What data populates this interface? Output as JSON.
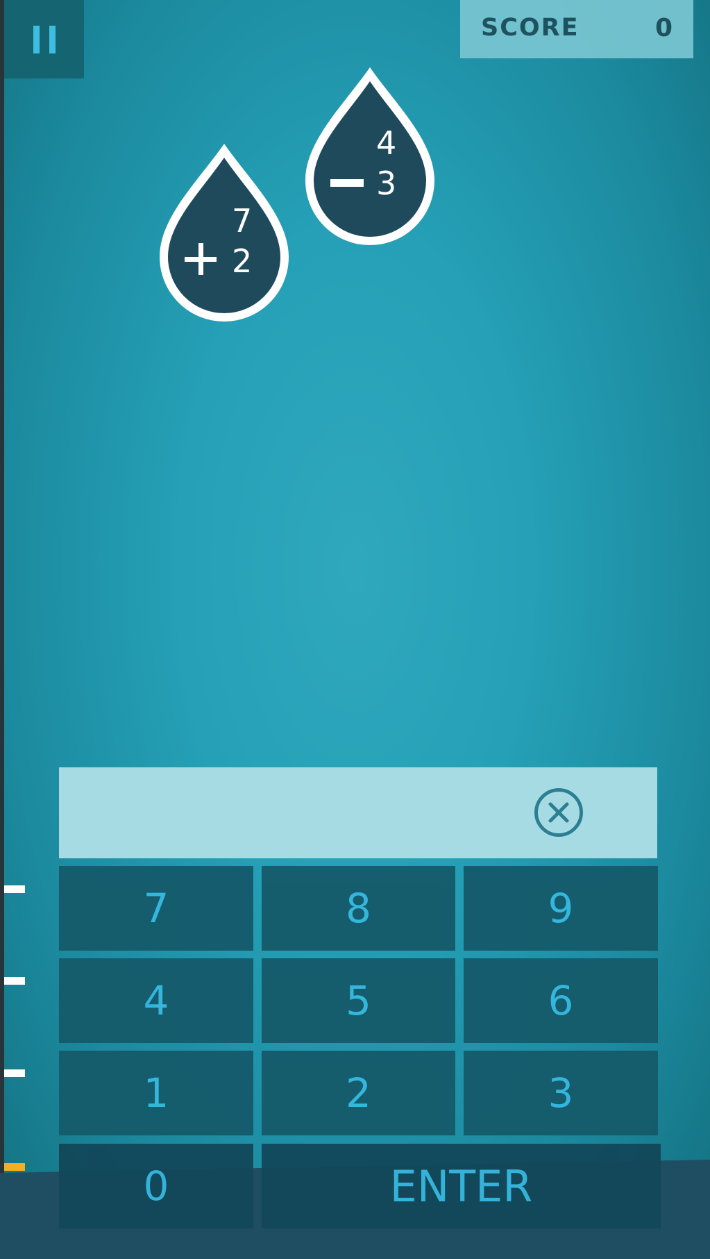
{
  "pause": {
    "icon": "pause-icon"
  },
  "score": {
    "label": "SCORE",
    "value": "0"
  },
  "drops": [
    {
      "top_number": "7",
      "bottom_number": "2",
      "operator": "+"
    },
    {
      "top_number": "4",
      "bottom_number": "3",
      "operator": "-"
    }
  ],
  "answer_input": {
    "value": "",
    "clear_icon": "clear-x-icon"
  },
  "keypad": {
    "k7": "7",
    "k8": "8",
    "k9": "9",
    "k4": "4",
    "k5": "5",
    "k6": "6",
    "k1": "1",
    "k2": "2",
    "k3": "3",
    "k0": "0",
    "enter": "ENTER"
  },
  "colors": {
    "background": "#25a0b6",
    "drop_fill": "#1f4a5c",
    "key_text": "#36b8e0",
    "current_level": "#f0b022"
  }
}
